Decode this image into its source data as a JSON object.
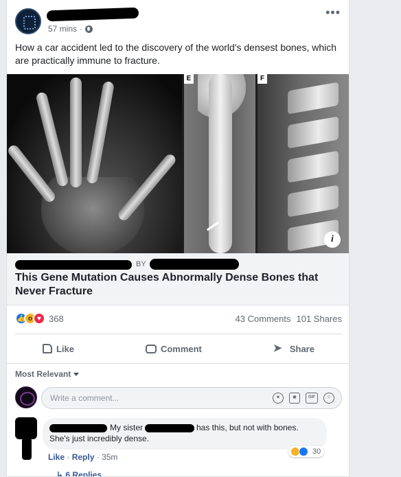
{
  "post": {
    "time": "57 mins",
    "separator": "·",
    "more_label": "•••",
    "text": "How a car accident led to the discovery of the world's densest bones, which are practically immune to fracture.",
    "image": {
      "panel_labels": [
        "E",
        "F"
      ],
      "info_label": "i"
    },
    "link": {
      "by_label": "BY",
      "title": "This Gene Mutation Causes Abnormally Dense Bones that Never Fracture"
    },
    "counts": {
      "reaction_count": "368",
      "comments": "43 Comments",
      "shares": "101 Shares"
    },
    "actions": {
      "like": "Like",
      "comment": "Comment",
      "share": "Share"
    }
  },
  "comments": {
    "sort_label": "Most Relevant",
    "input_placeholder": "Write a comment...",
    "input_icons": [
      "emoji-icon",
      "camera-icon",
      "gif-icon",
      "sticker-icon"
    ],
    "gif_label": "GIF",
    "items": [
      {
        "text_part1": "My sister",
        "text_part2": "has this, but not with bones.",
        "text_part3": "She's just incredibly dense.",
        "reaction_count": "30",
        "like_label": "Like",
        "reply_label": "Reply",
        "time": "35m"
      }
    ],
    "replies_label": "6 Replies"
  },
  "colors": {
    "link_blue": "#385898",
    "like_blue": "#1877f2",
    "wow_yellow": "#f7b125",
    "love_red": "#f0284a",
    "background": "#e9ebee"
  }
}
